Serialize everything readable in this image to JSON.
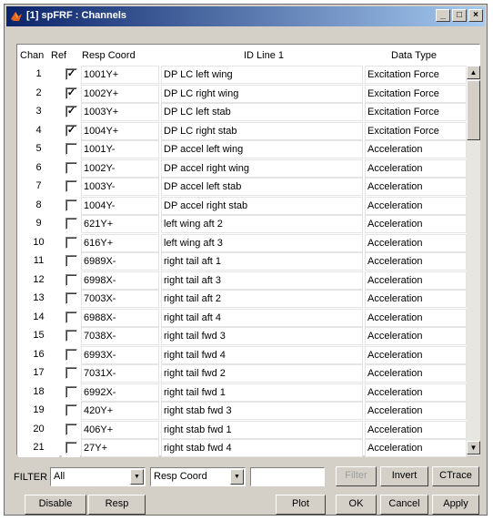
{
  "window": {
    "title": "[1] spFRF : Channels",
    "controls": {
      "minimize": "_",
      "maximize": "□",
      "close": "×"
    }
  },
  "table": {
    "headers": {
      "chan": "Chan",
      "ref": "Ref",
      "resp": "Resp Coord",
      "id": "ID Line 1",
      "type": "Data Type"
    },
    "rows": [
      {
        "chan": "1",
        "ref": true,
        "resp": "1001Y+",
        "id": "DP LC left wing",
        "type": "Excitation Force"
      },
      {
        "chan": "2",
        "ref": true,
        "resp": "1002Y+",
        "id": "DP LC right wing",
        "type": "Excitation Force"
      },
      {
        "chan": "3",
        "ref": true,
        "resp": "1003Y+",
        "id": "DP LC left stab",
        "type": "Excitation Force"
      },
      {
        "chan": "4",
        "ref": true,
        "resp": "1004Y+",
        "id": "DP LC right stab",
        "type": "Excitation Force"
      },
      {
        "chan": "5",
        "ref": false,
        "resp": "1001Y-",
        "id": "DP accel left wing",
        "type": "Acceleration"
      },
      {
        "chan": "6",
        "ref": false,
        "resp": "1002Y-",
        "id": "DP accel right wing",
        "type": "Acceleration"
      },
      {
        "chan": "7",
        "ref": false,
        "resp": "1003Y-",
        "id": "DP accel left stab",
        "type": "Acceleration"
      },
      {
        "chan": "8",
        "ref": false,
        "resp": "1004Y-",
        "id": "DP accel right stab",
        "type": "Acceleration"
      },
      {
        "chan": "9",
        "ref": false,
        "resp": "621Y+",
        "id": "left wing aft 2",
        "type": "Acceleration"
      },
      {
        "chan": "10",
        "ref": false,
        "resp": "616Y+",
        "id": "left wing aft 3",
        "type": "Acceleration"
      },
      {
        "chan": "11",
        "ref": false,
        "resp": "6989X-",
        "id": "right tail aft 1",
        "type": "Acceleration"
      },
      {
        "chan": "12",
        "ref": false,
        "resp": "6998X-",
        "id": "right tail aft 3",
        "type": "Acceleration"
      },
      {
        "chan": "13",
        "ref": false,
        "resp": "7003X-",
        "id": "right tail aft 2",
        "type": "Acceleration"
      },
      {
        "chan": "14",
        "ref": false,
        "resp": "6988X-",
        "id": "right tail aft 4",
        "type": "Acceleration"
      },
      {
        "chan": "15",
        "ref": false,
        "resp": "7038X-",
        "id": "right tail fwd 3",
        "type": "Acceleration"
      },
      {
        "chan": "16",
        "ref": false,
        "resp": "6993X-",
        "id": "right tail fwd 4",
        "type": "Acceleration"
      },
      {
        "chan": "17",
        "ref": false,
        "resp": "7031X-",
        "id": "right tail fwd 2",
        "type": "Acceleration"
      },
      {
        "chan": "18",
        "ref": false,
        "resp": "6992X-",
        "id": "right tail fwd 1",
        "type": "Acceleration"
      },
      {
        "chan": "19",
        "ref": false,
        "resp": "420Y+",
        "id": "right stab fwd 3",
        "type": "Acceleration"
      },
      {
        "chan": "20",
        "ref": false,
        "resp": "406Y+",
        "id": "right stab fwd 1",
        "type": "Acceleration"
      },
      {
        "chan": "21",
        "ref": false,
        "resp": "27Y+",
        "id": "right stab fwd 4",
        "type": "Acceleration"
      }
    ]
  },
  "filter": {
    "label": "FILTER",
    "select1": "All",
    "select2": "Resp Coord",
    "text": "",
    "filter_btn": "Filter",
    "invert_btn": "Invert",
    "ctrace_btn": "CTrace"
  },
  "actions": {
    "disable": "Disable",
    "resp": "Resp",
    "plot": "Plot",
    "ok": "OK",
    "cancel": "Cancel",
    "apply": "Apply"
  },
  "colors": {
    "title_start": "#0a246a",
    "title_end": "#a6caf0",
    "face": "#d4d0c8"
  }
}
